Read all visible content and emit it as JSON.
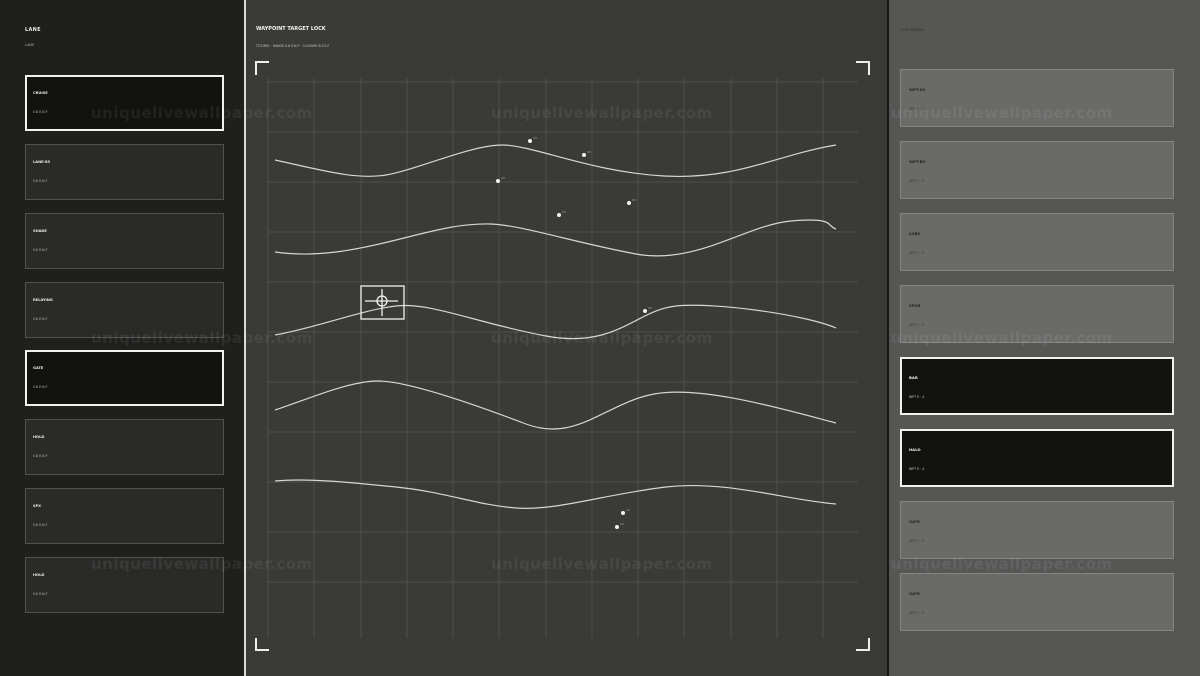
{
  "left_panel": {
    "title": "LANE",
    "subtitle": "LANE",
    "cards": [
      {
        "name": "CRUISE",
        "value": "0.8 E:N.F",
        "active": true
      },
      {
        "name": "LANE-85",
        "value": "0.8 E:N.F",
        "active": false
      },
      {
        "name": "SHADE",
        "value": "0.8 E:N.F",
        "active": false
      },
      {
        "name": "RELAYING",
        "value": "0.8 E:N.F",
        "active": false
      },
      {
        "name": "GATE",
        "value": "0.8 E:N.F",
        "active": true
      },
      {
        "name": "HOLD",
        "value": "0.8 E:N.F",
        "active": false
      },
      {
        "name": "SPX",
        "value": "0.8 E:N.F",
        "active": false
      },
      {
        "name": "HOLD",
        "value": "0.8 E:N.F",
        "active": false
      }
    ]
  },
  "center": {
    "title": "WAYPOINT TARGET LOCK",
    "subtitle": "TGT-WPL · RANGE 0.8 E:N.F · CLOSURE 8.0 E.F"
  },
  "right_panel": {
    "title": "LOCK BOARD",
    "cards": [
      {
        "name": "WPT-A3",
        "value": "WPT 0 · 4",
        "active": false
      },
      {
        "name": "WPT-B5",
        "value": "WPT 0 · 4",
        "active": false
      },
      {
        "name": "LOBE",
        "value": "WPT 0 · 4",
        "active": false
      },
      {
        "name": "SPUR",
        "value": "WPT 0 · 4",
        "active": false
      },
      {
        "name": "BAR",
        "value": "WPT 0 · 4",
        "active": true
      },
      {
        "name": "HALO",
        "value": "WPT 0 · 4",
        "active": true
      },
      {
        "name": "GATE",
        "value": "WPT 0 · 4",
        "active": false
      },
      {
        "name": "GATE",
        "value": "WPT 0 · 4",
        "active": false
      }
    ]
  },
  "watermark": "uniquelivewallpaper.com",
  "colors": {
    "left_bg": "#1f201e",
    "center_bg": "#3a3b39",
    "right_bg": "#565755",
    "active_card": "#121311",
    "line": "#d6d6d2"
  },
  "icons": {
    "target_reticle": "crosshair-icon"
  }
}
